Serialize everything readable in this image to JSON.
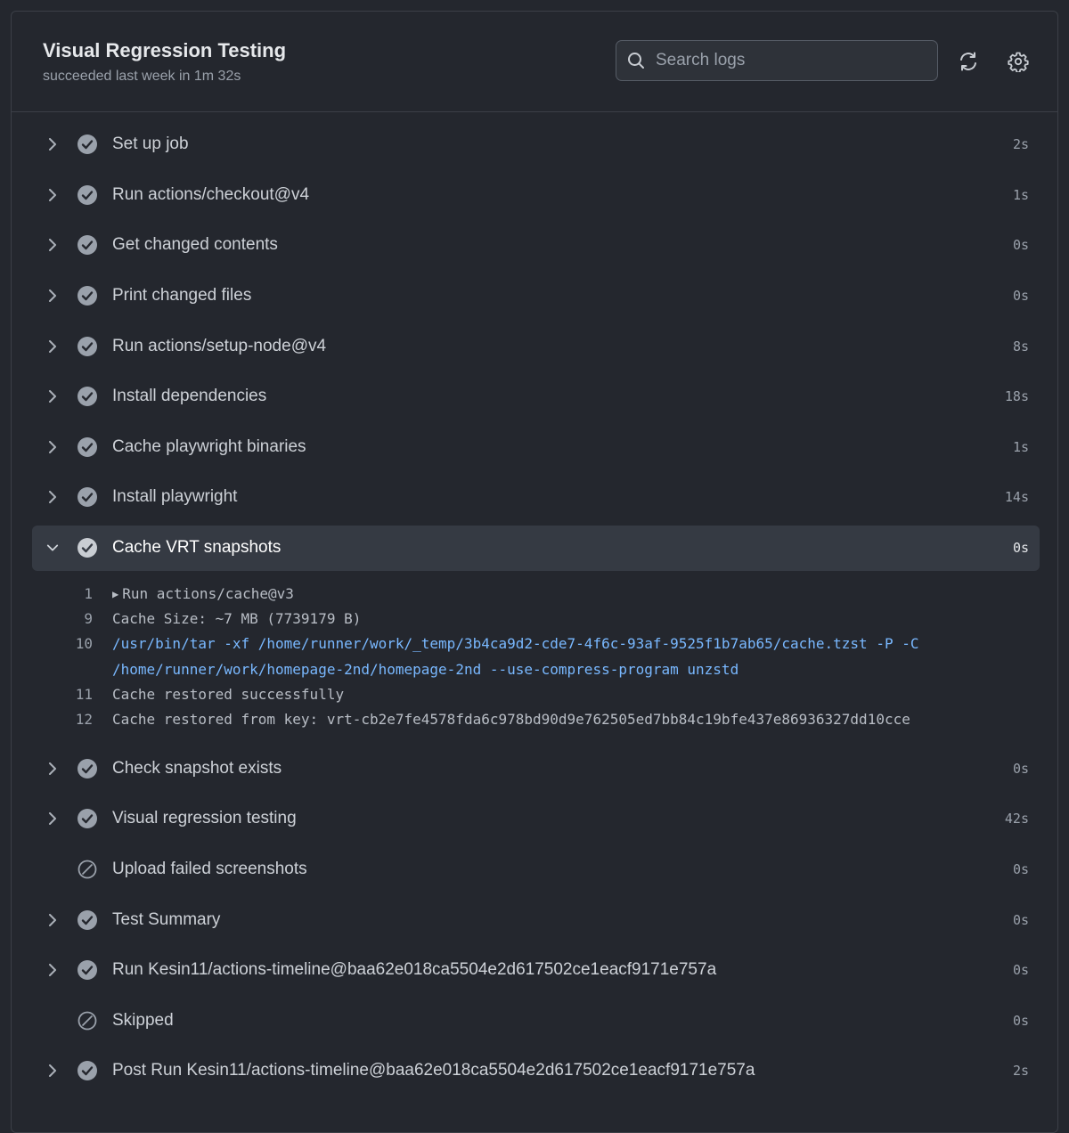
{
  "header": {
    "title": "Visual Regression Testing",
    "subtitle": "succeeded last week in 1m 32s",
    "search_placeholder": "Search logs"
  },
  "colors": {
    "background": "#24272e",
    "success_icon": "#9aa1ab",
    "command_text": "#79b8ff",
    "expanded_row": "#353a43"
  },
  "steps": [
    {
      "label": "Set up job",
      "duration": "2s",
      "status": "success",
      "icon": "check-circle-icon"
    },
    {
      "label": "Run actions/checkout@v4",
      "duration": "1s",
      "status": "success",
      "icon": "check-circle-icon"
    },
    {
      "label": "Get changed contents",
      "duration": "0s",
      "status": "success",
      "icon": "check-circle-icon"
    },
    {
      "label": "Print changed files",
      "duration": "0s",
      "status": "success",
      "icon": "check-circle-icon"
    },
    {
      "label": "Run actions/setup-node@v4",
      "duration": "8s",
      "status": "success",
      "icon": "check-circle-icon"
    },
    {
      "label": "Install dependencies",
      "duration": "18s",
      "status": "success",
      "icon": "check-circle-icon"
    },
    {
      "label": "Cache playwright binaries",
      "duration": "1s",
      "status": "success",
      "icon": "check-circle-icon"
    },
    {
      "label": "Install playwright",
      "duration": "14s",
      "status": "success",
      "icon": "check-circle-icon"
    },
    {
      "label": "Cache VRT snapshots",
      "duration": "0s",
      "status": "success",
      "icon": "check-circle-icon",
      "expanded": true
    },
    {
      "label": "Check snapshot exists",
      "duration": "0s",
      "status": "success",
      "icon": "check-circle-icon"
    },
    {
      "label": "Visual regression testing",
      "duration": "42s",
      "status": "success",
      "icon": "check-circle-icon"
    },
    {
      "label": "Upload failed screenshots",
      "duration": "0s",
      "status": "skipped",
      "icon": "skipped-icon"
    },
    {
      "label": "Test Summary",
      "duration": "0s",
      "status": "success",
      "icon": "check-circle-icon"
    },
    {
      "label": "Run Kesin11/actions-timeline@baa62e018ca5504e2d617502ce1eacf9171e757a",
      "duration": "0s",
      "status": "success",
      "icon": "check-circle-icon"
    },
    {
      "label": "Skipped",
      "duration": "0s",
      "status": "skipped",
      "icon": "skipped-icon"
    },
    {
      "label": "Post Run Kesin11/actions-timeline@baa62e018ca5504e2d617502ce1eacf9171e757a",
      "duration": "2s",
      "status": "success",
      "icon": "check-circle-icon"
    }
  ],
  "log_lines": [
    {
      "num": "1",
      "text": "Run actions/cache@v3",
      "collapsible": true
    },
    {
      "num": "9",
      "text": "Cache Size: ~7 MB (7739179 B)"
    },
    {
      "num": "10",
      "text": "/usr/bin/tar -xf /home/runner/work/_temp/3b4ca9d2-cde7-4f6c-93af-9525f1b7ab65/cache.tzst -P -C",
      "cmd": true
    },
    {
      "num": "",
      "text": "/home/runner/work/homepage-2nd/homepage-2nd --use-compress-program unzstd",
      "cmd": true,
      "continuation": true
    },
    {
      "num": "11",
      "text": "Cache restored successfully"
    },
    {
      "num": "12",
      "text": "Cache restored from key: vrt-cb2e7fe4578fda6c978bd90d9e762505ed7bb84c19bfe437e86936327dd10cce"
    }
  ]
}
